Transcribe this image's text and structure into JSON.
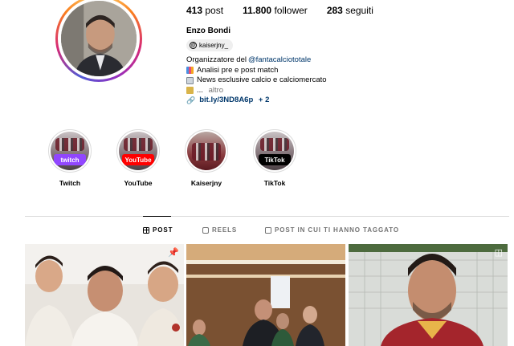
{
  "profile": {
    "name": "Enzo Bondi",
    "threads_handle": "kaiserjny_",
    "stats": {
      "posts": "413",
      "posts_label": "post",
      "followers": "11.800",
      "followers_label": "follower",
      "following": "283",
      "following_label": "seguiti"
    }
  },
  "bio": {
    "line1_prefix": "Organizzatore del ",
    "line1_mention": "@fantacalciototale",
    "line2": "Analisi pre e post match",
    "line3": "News esclusive calcio e calciomercato",
    "line4_prefix": "...",
    "line4_more": "altro",
    "link": "bit.ly/3ND8A6p",
    "link_more": "+ 2"
  },
  "highlights": [
    {
      "label": "Twitch",
      "badge": "twitch",
      "badge_color": "#9146ff"
    },
    {
      "label": "YouTube",
      "badge": "YouTube",
      "badge_color": "#ff0000"
    },
    {
      "label": "Kaiserjny",
      "badge": "",
      "badge_color": "#8a1c2a"
    },
    {
      "label": "TikTok",
      "badge": "TikTok",
      "badge_color": "#000000"
    }
  ],
  "tabs": [
    {
      "label": "POST",
      "icon": "grid-icon",
      "active": true
    },
    {
      "label": "REELS",
      "icon": "reels-icon",
      "active": false
    },
    {
      "label": "POST IN CUI TI HANNO TAGGATO",
      "icon": "tagged-icon",
      "active": false
    }
  ],
  "posts": [
    {
      "type": "pinned",
      "icon": "pin-icon"
    },
    {
      "type": "photo",
      "icon": ""
    },
    {
      "type": "reel",
      "icon": "reel-icon"
    }
  ],
  "colors": {
    "link": "#00376b",
    "muted": "#737373",
    "divider": "#dbdbdb"
  }
}
